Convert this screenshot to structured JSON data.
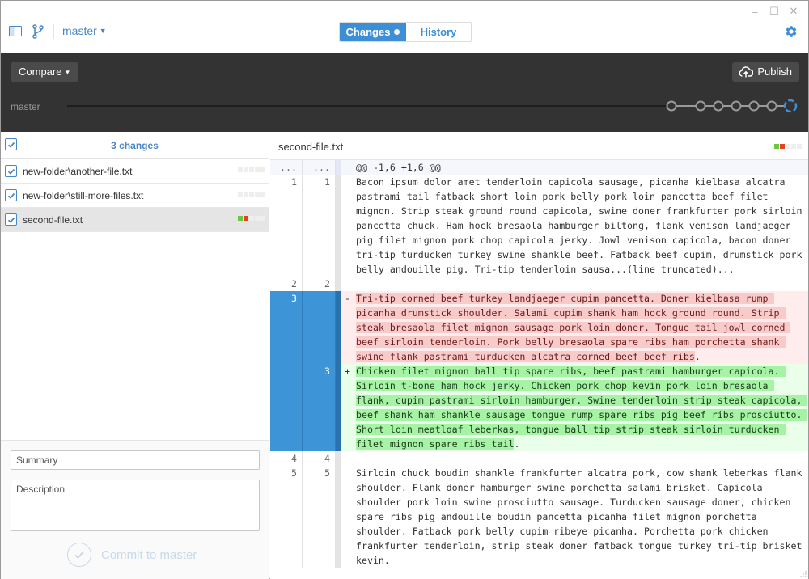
{
  "window": {
    "controls": {
      "minimize": "–",
      "maximize": "☐",
      "close": "✕"
    }
  },
  "toolbar": {
    "branch": "master",
    "tabs": [
      {
        "label": "Changes",
        "active": true,
        "has_indicator": true
      },
      {
        "label": "History",
        "active": false
      }
    ],
    "icons": [
      "sidebar-toggle-icon",
      "branch-icon",
      "gear-icon"
    ]
  },
  "darkbar": {
    "compare_label": "Compare",
    "publish_label": "Publish",
    "timeline_branch": "master",
    "timeline_commits": 7,
    "accent": "#3c8fd6"
  },
  "changes": {
    "count_label": "3 changes",
    "all_checked": true,
    "files": [
      {
        "name": "new-folder\\another-file.txt",
        "checked": true,
        "selected": false,
        "diffstat": [
          "none",
          "none",
          "none",
          "none",
          "none"
        ]
      },
      {
        "name": "new-folder\\still-more-files.txt",
        "checked": true,
        "selected": false,
        "diffstat": [
          "none",
          "none",
          "none",
          "none",
          "none"
        ]
      },
      {
        "name": "second-file.txt",
        "checked": true,
        "selected": true,
        "diffstat": [
          "add",
          "del",
          "none",
          "none",
          "none"
        ]
      }
    ]
  },
  "commit": {
    "summary_placeholder": "Summary",
    "description_placeholder": "Description",
    "button_label": "Commit to master"
  },
  "diff": {
    "filename": "second-file.txt",
    "diffstat": [
      "add",
      "del",
      "none",
      "none",
      "none"
    ],
    "lines": [
      {
        "type": "hunk",
        "old": "...",
        "new": "...",
        "mark": "",
        "text": "@@ -1,6 +1,6 @@"
      },
      {
        "type": "ctx",
        "old": "1",
        "new": "1",
        "mark": "",
        "text": "Bacon ipsum dolor amet tenderloin capicola sausage, picanha kielbasa alcatra pastrami tail fatback short loin pork belly pork loin pancetta beef filet mignon. Strip steak ground round capicola, swine doner frankfurter pork sirloin pancetta chuck. Ham hock bresaola hamburger biltong, flank venison landjaeger pig filet mignon pork chop capicola jerky. Jowl venison capicola, bacon doner tri-tip turducken turkey swine shankle beef. Fatback beef cupim, drumstick pork belly andouille pig. Tri-tip tenderloin sausa...(line truncated)..."
      },
      {
        "type": "ctx",
        "old": "2",
        "new": "2",
        "mark": "",
        "text": ""
      },
      {
        "type": "del",
        "old": "3",
        "new": "",
        "mark": "-",
        "text": "Tri-tip corned beef turkey landjaeger cupim pancetta. Doner kielbasa rump picanha drumstick shoulder. Salami cupim shank ham hock ground round. Strip steak bresaola filet mignon sausage pork loin doner. Tongue tail jowl corned beef sirloin tenderloin. Pork belly bresaola spare ribs ham porchetta shank swine flank pastrami turducken alcatra corned beef beef ribs",
        "tail": "."
      },
      {
        "type": "add",
        "old": "",
        "new": "3",
        "mark": "+",
        "text": "Chicken filet mignon ball tip spare ribs, beef pastrami hamburger capicola. Sirloin t-bone ham hock jerky. Chicken pork chop kevin pork loin bresaola flank, cupim pastrami sirloin hamburger. Swine tenderloin strip steak capicola, beef shank ham shankle sausage tongue rump spare ribs pig beef ribs prosciutto. Short loin meatloaf leberkas, tongue ball tip strip steak sirloin turducken filet mignon spare ribs tail",
        "tail": "."
      },
      {
        "type": "ctx",
        "old": "4",
        "new": "4",
        "mark": "",
        "text": ""
      },
      {
        "type": "ctx",
        "old": "5",
        "new": "5",
        "mark": "",
        "text": "Sirloin chuck boudin shankle frankfurter alcatra pork, cow shank leberkas flank shoulder. Flank doner hamburger swine porchetta salami brisket. Capicola shoulder pork loin swine prosciutto sausage. Turducken sausage doner, chicken spare ribs pig andouille boudin pancetta picanha filet mignon porchetta shoulder. Fatback pork belly cupim ribeye picanha. Porchetta pork chicken frankfurter tenderloin, strip steak doner fatback tongue turkey tri-tip brisket kevin."
      }
    ]
  }
}
